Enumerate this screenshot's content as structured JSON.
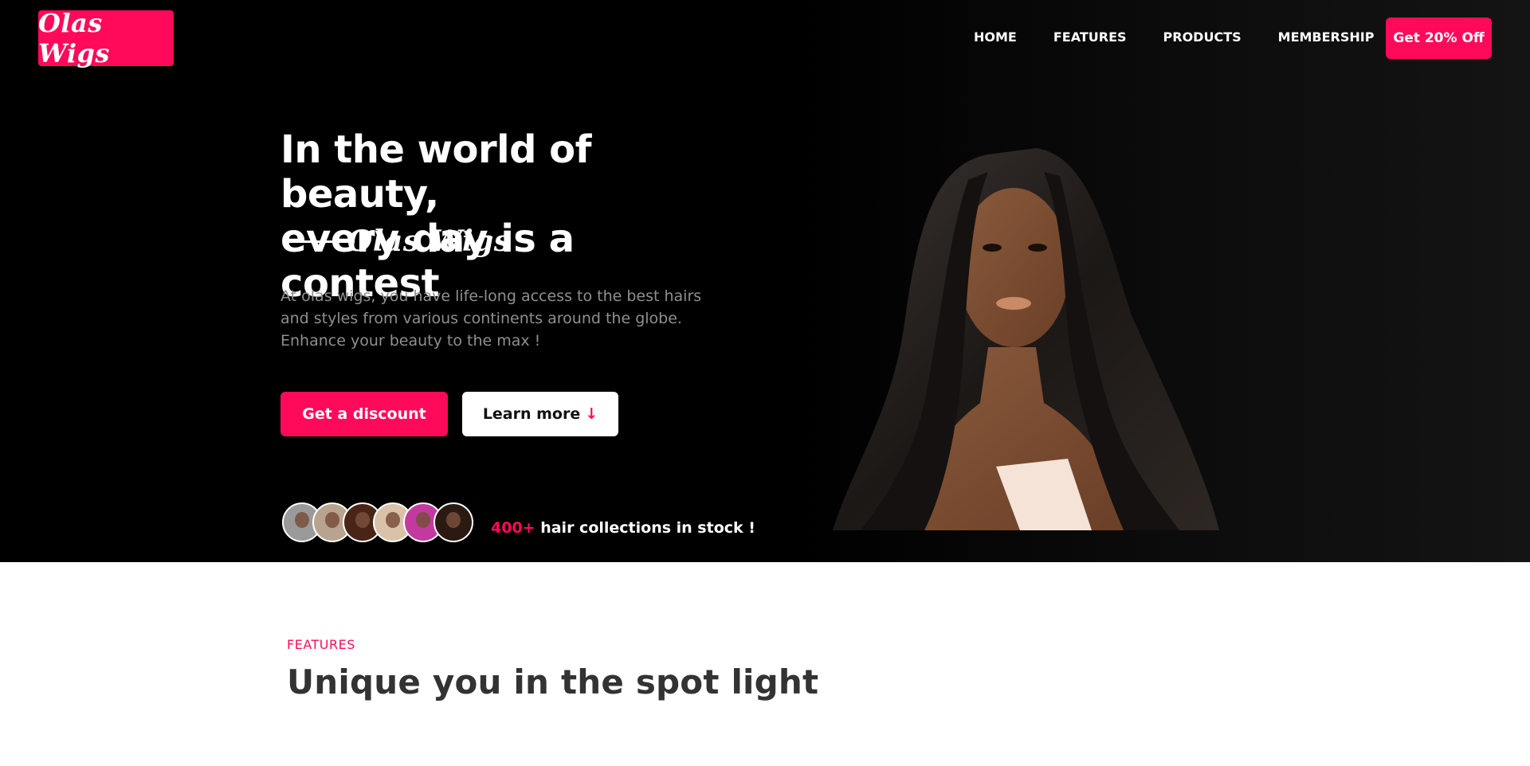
{
  "brand": {
    "logo_text": "Olas Wigs",
    "accent_color": "#ff0a5a"
  },
  "nav": {
    "items": [
      {
        "label": "HOME"
      },
      {
        "label": "FEATURES"
      },
      {
        "label": "PRODUCTS"
      },
      {
        "label": "MEMBERSHIP"
      }
    ],
    "cta_label": "Get 20% Off"
  },
  "hero": {
    "headline_line1": "In the world of beauty,",
    "headline_line2": "every day is a contest",
    "signature": "Olas Wigs",
    "description": "At olas wigs, you have life-long access to the best hairs and styles from various continents around the globe. Enhance your beauty to the max !",
    "primary_button": "Get a discount",
    "secondary_button": "Learn more",
    "secondary_icon": "↓",
    "stock_count": "400+",
    "stock_text": " hair collections in stock !",
    "avatar_colors": [
      "#9a9a9a",
      "#b8a48e",
      "#4a2416",
      "#d9c2a8",
      "#c23aa0",
      "#2a1a12"
    ]
  },
  "features": {
    "label": "FEATURES",
    "title": "Unique you in the spot light"
  }
}
